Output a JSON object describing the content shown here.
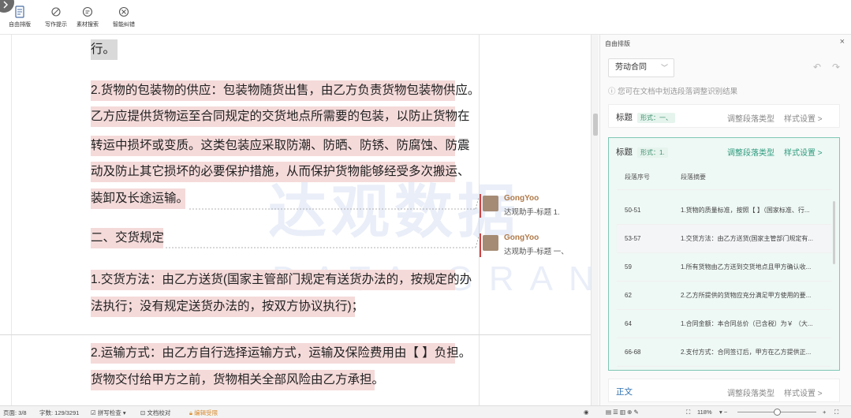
{
  "toolbar": {
    "items": [
      {
        "label": "自由排版",
        "icon": "layout-icon"
      },
      {
        "label": "写作提示",
        "icon": "writing-hint-icon"
      },
      {
        "label": "素材搜索",
        "icon": "material-search-icon"
      },
      {
        "label": "智能纠错",
        "icon": "smart-correct-icon"
      }
    ]
  },
  "document": {
    "line0": "行。",
    "p1": [
      "2.货物的包装物的供应：包装物随货出售，由乙方负责货物包装物供应。",
      "乙方应提供货物运至合同规定的交货地点所需要的包装，以防止货物在",
      "转运中损坏或变质。这类包装应采取防潮、防晒、防锈、防腐蚀、防震",
      "动及防止其它损坏的必要保护措施，从而保护货物能够经受多次搬运、",
      "装卸及长途运输。"
    ],
    "heading": "二、交货规定",
    "p2": [
      "1.交货方法：由乙方送货(国家主管部门规定有送货办法的，按规定的办",
      "法执行；没有规定送货办法的，按双方协议执行)；"
    ],
    "p3": [
      "2.运输方式：由乙方自行选择运输方式，运输及保险费用由【 】负担。",
      "货物交付给甲方之前，货物相关全部风险由乙方承担。"
    ],
    "watermark_cn": "达观数据",
    "watermark_en": "DATA GRAND"
  },
  "comments": [
    {
      "author": "GongYoo",
      "text": "达观助手-标题 1."
    },
    {
      "author": "GongYoo",
      "text": "达观助手-标题 一、"
    }
  ],
  "panel": {
    "title": "自由排版",
    "close": "×",
    "select_value": "劳动合同",
    "hint": "您可在文档中划选段落调整识别结果",
    "cards": [
      {
        "title": "标题",
        "badge": "形式：一、",
        "act1": "调整段落类型",
        "act2": "样式设置 >"
      },
      {
        "title": "标题",
        "badge": "形式：1.",
        "act1": "调整段落类型",
        "act2": "样式设置 >"
      },
      {
        "title": "正文",
        "badge": "",
        "act1": "调整段落类型",
        "act2": "样式设置 >"
      }
    ],
    "table": {
      "headers": [
        "段落序号",
        "段落摘要"
      ],
      "rows": [
        {
          "no": "50-51",
          "summary": "1.货物的质量标准，按照【 】（国家标准、行..."
        },
        {
          "no": "53-57",
          "summary": "1.交货方法：由乙方送货(国家主管部门规定有..."
        },
        {
          "no": "59",
          "summary": "1.所有货物由乙方送到交货地点且甲方确认收..."
        },
        {
          "no": "62",
          "summary": "2.乙方所提供的货物应充分满足甲方使用的要..."
        },
        {
          "no": "64",
          "summary": "1.合同金额：本合同总价（已含税）为￥ （大..."
        },
        {
          "no": "66-68",
          "summary": "2.支付方式：合同签订后，甲方在乙方提供正..."
        }
      ]
    }
  },
  "status": {
    "page": "页面: 3/8",
    "words": "字数: 129/3291",
    "spell": "拼写检查",
    "proof": "文档校对",
    "track": "编辑受限",
    "zoom": "118%"
  },
  "colors": {
    "highlight": "#f5dada",
    "accent": "#2e9b7e",
    "comment_name": "#b07a4a"
  }
}
